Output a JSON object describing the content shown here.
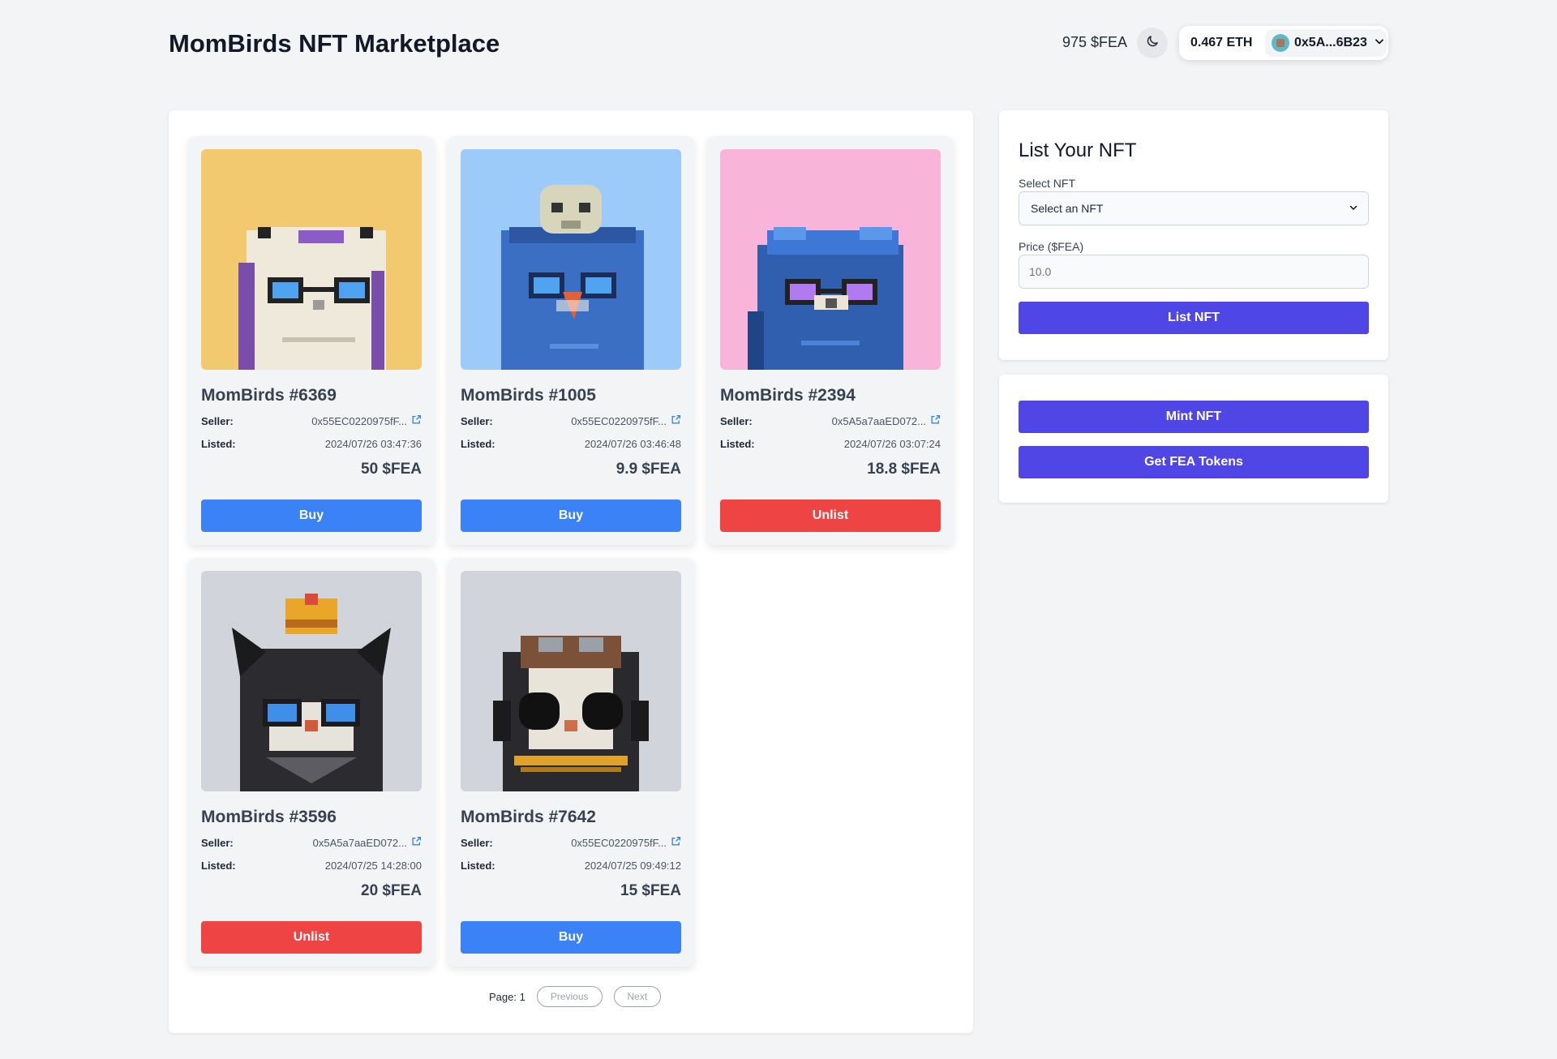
{
  "header": {
    "title": "MomBirds NFT Marketplace",
    "fea_balance": "975 $FEA",
    "eth_balance": "0.467 ETH",
    "address": "0x5A...6B23"
  },
  "icons": {
    "theme": "moon-icon",
    "dropdown": "chevron-down-icon",
    "external": "external-link-icon"
  },
  "listings": [
    {
      "name": "MomBirds #6369",
      "seller_label": "Seller:",
      "seller": "0x55EC0220975fF...",
      "listed_label": "Listed:",
      "listed": "2024/07/26 03:47:36",
      "price": "50 $FEA",
      "action": "Buy",
      "bg": "#f3c96f"
    },
    {
      "name": "MomBirds #1005",
      "seller_label": "Seller:",
      "seller": "0x55EC0220975fF...",
      "listed_label": "Listed:",
      "listed": "2024/07/26 03:46:48",
      "price": "9.9 $FEA",
      "action": "Buy",
      "bg": "#9ccbfa"
    },
    {
      "name": "MomBirds #2394",
      "seller_label": "Seller:",
      "seller": "0x5A5a7aaED072...",
      "listed_label": "Listed:",
      "listed": "2024/07/26 03:07:24",
      "price": "18.8 $FEA",
      "action": "Unlist",
      "bg": "#f9b5d9"
    },
    {
      "name": "MomBirds #3596",
      "seller_label": "Seller:",
      "seller": "0x5A5a7aaED072...",
      "listed_label": "Listed:",
      "listed": "2024/07/25 14:28:00",
      "price": "20 $FEA",
      "action": "Unlist",
      "bg": "#d1d5db"
    },
    {
      "name": "MomBirds #7642",
      "seller_label": "Seller:",
      "seller": "0x55EC0220975fF...",
      "listed_label": "Listed:",
      "listed": "2024/07/25 09:49:12",
      "price": "15 $FEA",
      "action": "Buy",
      "bg": "#d1d5db"
    }
  ],
  "pagination": {
    "page_label": "Page: 1",
    "previous": "Previous",
    "next": "Next"
  },
  "list_form": {
    "title": "List Your NFT",
    "select_label": "Select NFT",
    "select_value": "Select an NFT",
    "price_label": "Price ($FEA)",
    "price_placeholder": "10.0",
    "submit": "List NFT"
  },
  "actions": {
    "mint": "Mint NFT",
    "get_tokens": "Get FEA Tokens"
  },
  "colors": {
    "buy": "#3b82f6",
    "unlist": "#ef4444",
    "primary": "#4f46e5"
  }
}
